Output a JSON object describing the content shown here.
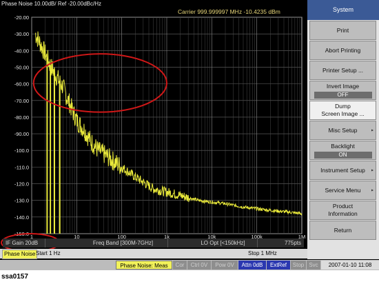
{
  "screen": {
    "title": "Phase Noise 10.00dB/ Ref -20.00dBc/Hz",
    "carrier": "Carrier 999.999997 MHz   -10.4235 dBm"
  },
  "chart_data": {
    "type": "line",
    "title": "Phase Noise 10.00dB/ Ref -20.00dBc/Hz",
    "xscale": "log",
    "xlim": [
      1,
      1000000
    ],
    "ylim": [
      -150,
      -20
    ],
    "x_tick_labels": [
      "1",
      "10",
      "100",
      "1k",
      "10k",
      "100k",
      "1M"
    ],
    "x_tick_values": [
      1,
      10,
      100,
      1000,
      10000,
      100000,
      1000000
    ],
    "y_tick_labels": [
      "-20.00",
      "-30.00",
      "-40.00",
      "-50.00",
      "-60.00",
      "-70.00",
      "-80.00",
      "-90.00",
      "-100.0",
      "-110.0",
      "-120.0",
      "-130.0",
      "-140.0",
      "-150.0"
    ],
    "y_tick_values": [
      -20,
      -30,
      -40,
      -50,
      -60,
      -70,
      -80,
      -90,
      -100,
      -110,
      -120,
      -130,
      -140,
      -150
    ],
    "grid": true,
    "trace_color": "#e8e83a",
    "series": [
      {
        "x": [
          1.2,
          1.5,
          2,
          2.5,
          3,
          4,
          5,
          6,
          7,
          8,
          10,
          15,
          20,
          30,
          50,
          70,
          100,
          200,
          300,
          500,
          700,
          1000,
          2000,
          5000,
          10000,
          20000,
          50000,
          100000,
          200000,
          500000,
          1000000
        ],
        "y": [
          -30,
          -35,
          -42,
          -48,
          -52,
          -58,
          -62,
          -68,
          -72,
          -76,
          -82,
          -88,
          -94,
          -100,
          -104,
          -107,
          -110,
          -116,
          -119,
          -123,
          -124,
          -125,
          -127,
          -130,
          -131,
          -132,
          -134,
          -135,
          -136,
          -137,
          -138
        ]
      }
    ],
    "spurs": [
      {
        "x": 2.2,
        "y": -150
      },
      {
        "x": 2.6,
        "y": -150
      },
      {
        "x": 3.2,
        "y": -150
      },
      {
        "x": 4.2,
        "y": -150
      }
    ],
    "annotations": [
      {
        "shape": "ellipse",
        "color": "#d01818",
        "x_range": [
          1.1,
          1000
        ],
        "y_range": [
          -77,
          -42
        ]
      },
      {
        "shape": "ellipse",
        "color": "#d01818",
        "target": "if-gain-status"
      }
    ]
  },
  "status_bar": {
    "if_gain": "IF Gain 20dB",
    "freq_band": "Freq Band [300M-7GHz]",
    "lo_opt": "LO Opt [<150kHz]",
    "points": "775pts"
  },
  "channel_bar": {
    "name": "Phase Noise",
    "start": "Start 1 Hz",
    "stop": "Stop 1 MHz"
  },
  "bottom_bar": {
    "meas": "Phase Noise: Meas",
    "cor": "Cor",
    "ctrl": "Ctrl 0V",
    "pow": "Pow 0V",
    "attn": "Attn 0dB",
    "extref": "ExtRef",
    "stop": "Stop",
    "svc": "Svc",
    "datetime": "2007-01-10 11:08"
  },
  "softkeys": {
    "header": "System",
    "print": "Print",
    "abort_printing": "Abort Printing",
    "printer_setup": "Printer Setup ...",
    "invert_image": "Invert Image",
    "invert_image_value": "OFF",
    "dump_line1": "Dump",
    "dump_line2": "Screen Image ...",
    "misc_setup": "Misc Setup",
    "backlight": "Backlight",
    "backlight_value": "ON",
    "instrument_setup": "Instrument Setup",
    "service_menu": "Service Menu",
    "product_line1": "Product",
    "product_line2": "Information",
    "return": "Return",
    "arrow": "▸"
  },
  "caption": "ssa0157"
}
